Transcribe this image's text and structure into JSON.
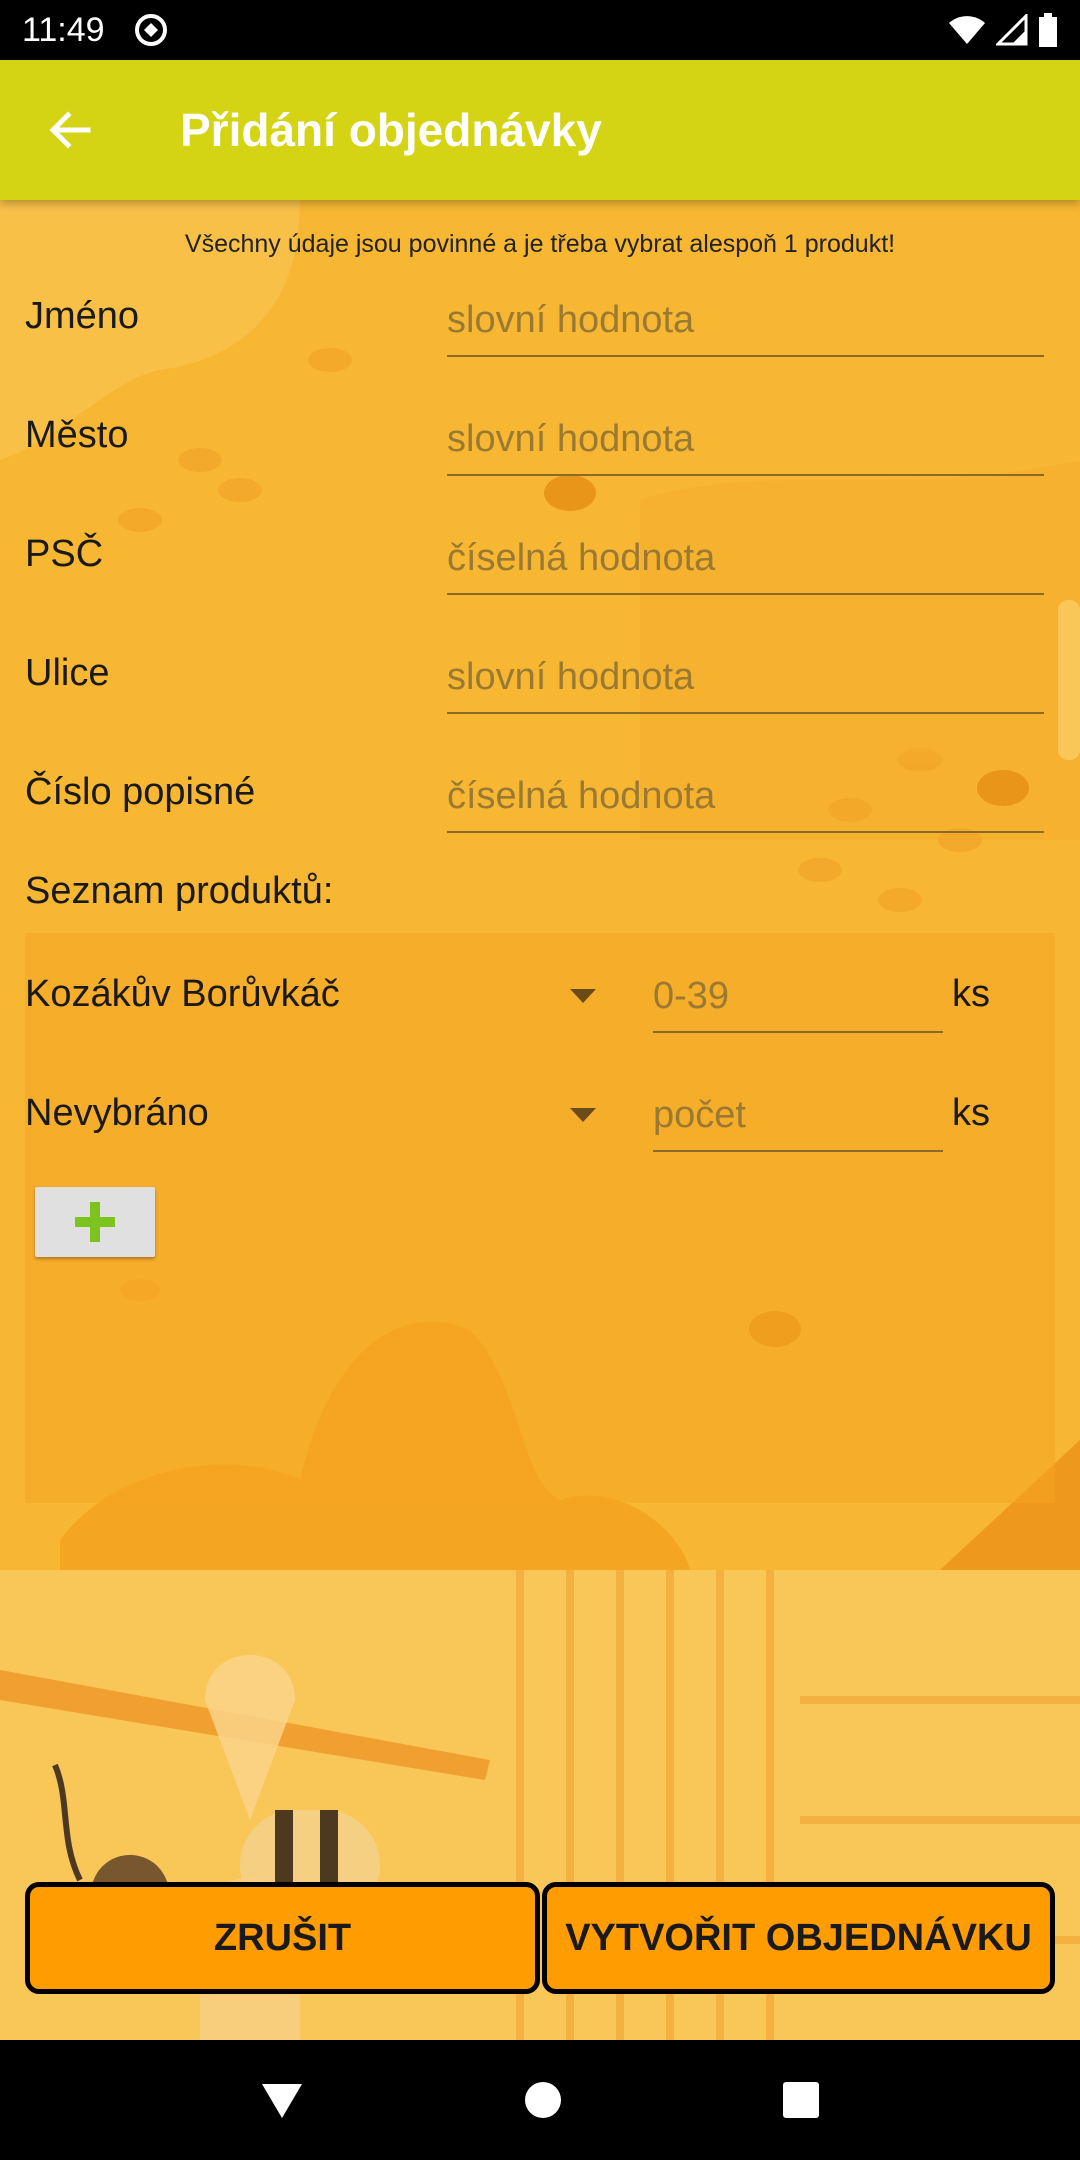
{
  "status_bar": {
    "time": "11:49"
  },
  "app_bar": {
    "title": "Přidání objednávky"
  },
  "notice": "Všechny údaje jsou povinné a je třeba vybrat alespoň 1 produkt!",
  "form": {
    "fields": [
      {
        "label": "Jméno",
        "placeholder": "slovní hodnota"
      },
      {
        "label": "Město",
        "placeholder": "slovní hodnota"
      },
      {
        "label": "PSČ",
        "placeholder": "číselná hodnota"
      },
      {
        "label": "Ulice",
        "placeholder": "slovní hodnota"
      },
      {
        "label": "Číslo popisné",
        "placeholder": "číselná hodnota"
      }
    ]
  },
  "products": {
    "title": "Seznam produktů:",
    "rows": [
      {
        "product": "Kozákův Borůvkáč",
        "qty_placeholder": "0-39",
        "unit": "ks"
      },
      {
        "product": "Nevybráno",
        "qty_placeholder": "počet",
        "unit": "ks"
      }
    ]
  },
  "buttons": {
    "cancel": "ZRUŠIT",
    "create": "VYTVOŘIT OBJEDNÁVKU"
  },
  "colors": {
    "app_bar": "#d4d314",
    "background": "#f7b733",
    "button": "#ff9c00",
    "add_icon": "#7cc31f"
  }
}
